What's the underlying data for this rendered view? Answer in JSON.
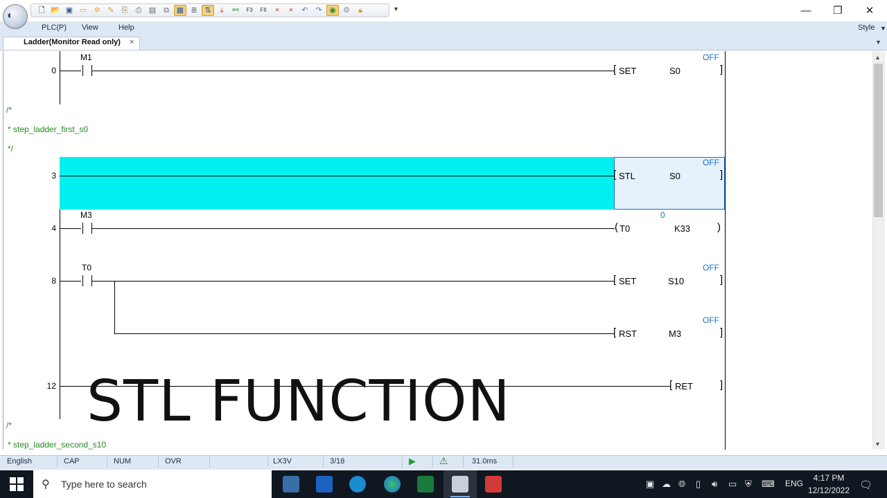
{
  "window": {
    "minimize_glyph": "—",
    "restore_glyph": "❐",
    "close_glyph": "✕",
    "qat_dropdown": "▾",
    "qat_icons": [
      "new-file",
      "open-folder",
      "save-as",
      "open",
      "unknown",
      "unknown",
      "copy",
      "print",
      "save",
      "duplicate",
      "monitor",
      "find",
      "transfer",
      "download",
      "network",
      "F3",
      "FII",
      "cF3",
      "cFII",
      "undo",
      "redo",
      "online",
      "settings",
      "lock"
    ],
    "logo_glyph": "◐"
  },
  "menu": {
    "items": [
      "PLC(P)",
      "View",
      "Help"
    ],
    "style_label": "Style"
  },
  "tab": {
    "label": "Ladder(Monitor Read only)",
    "close": "×",
    "menu": "▼"
  },
  "ladder": {
    "rungs": [
      {
        "step": "0",
        "contact": "M1",
        "instr": "SET",
        "operand": "S0",
        "monitor": "OFF"
      },
      {
        "step": "3",
        "instr": "STL",
        "operand": "S0",
        "monitor": "OFF"
      },
      {
        "step": "4",
        "contact": "M3",
        "instr": "T0",
        "operand": "K33",
        "monitor": "0"
      },
      {
        "step": "8",
        "contact": "T0",
        "instr": "SET",
        "operand": "S10",
        "monitor": "OFF"
      },
      {
        "instr": "RST",
        "operand": "M3",
        "monitor": "OFF"
      },
      {
        "step": "12",
        "instr": "RET"
      }
    ],
    "comments": [
      {
        "lines": [
          "/*",
          "* step_ladder_first_s0",
          "*/"
        ]
      },
      {
        "lines": [
          "/*",
          "* step_ladder_second_s10"
        ]
      }
    ],
    "overlay_text": "STL FUNCTION"
  },
  "status": {
    "language": "English",
    "cap": "CAP",
    "num": "NUM",
    "ovr": "OVR",
    "plc_model": "LX3V",
    "page": "3/18",
    "scan_time": "31.0ms",
    "run_icon": "play-icon",
    "warn_icon": "warning-icon"
  },
  "taskbar": {
    "search_placeholder": "Type here to search",
    "lang": "ENG",
    "time": "4:17 PM",
    "date": "12/12/2022"
  },
  "colors": {
    "selection": "#00f0f0",
    "selected_cell": "#e5f1fb",
    "selected_border": "#1c6fc4",
    "comment": "#228b22",
    "monitor": "#1c6fc4"
  }
}
